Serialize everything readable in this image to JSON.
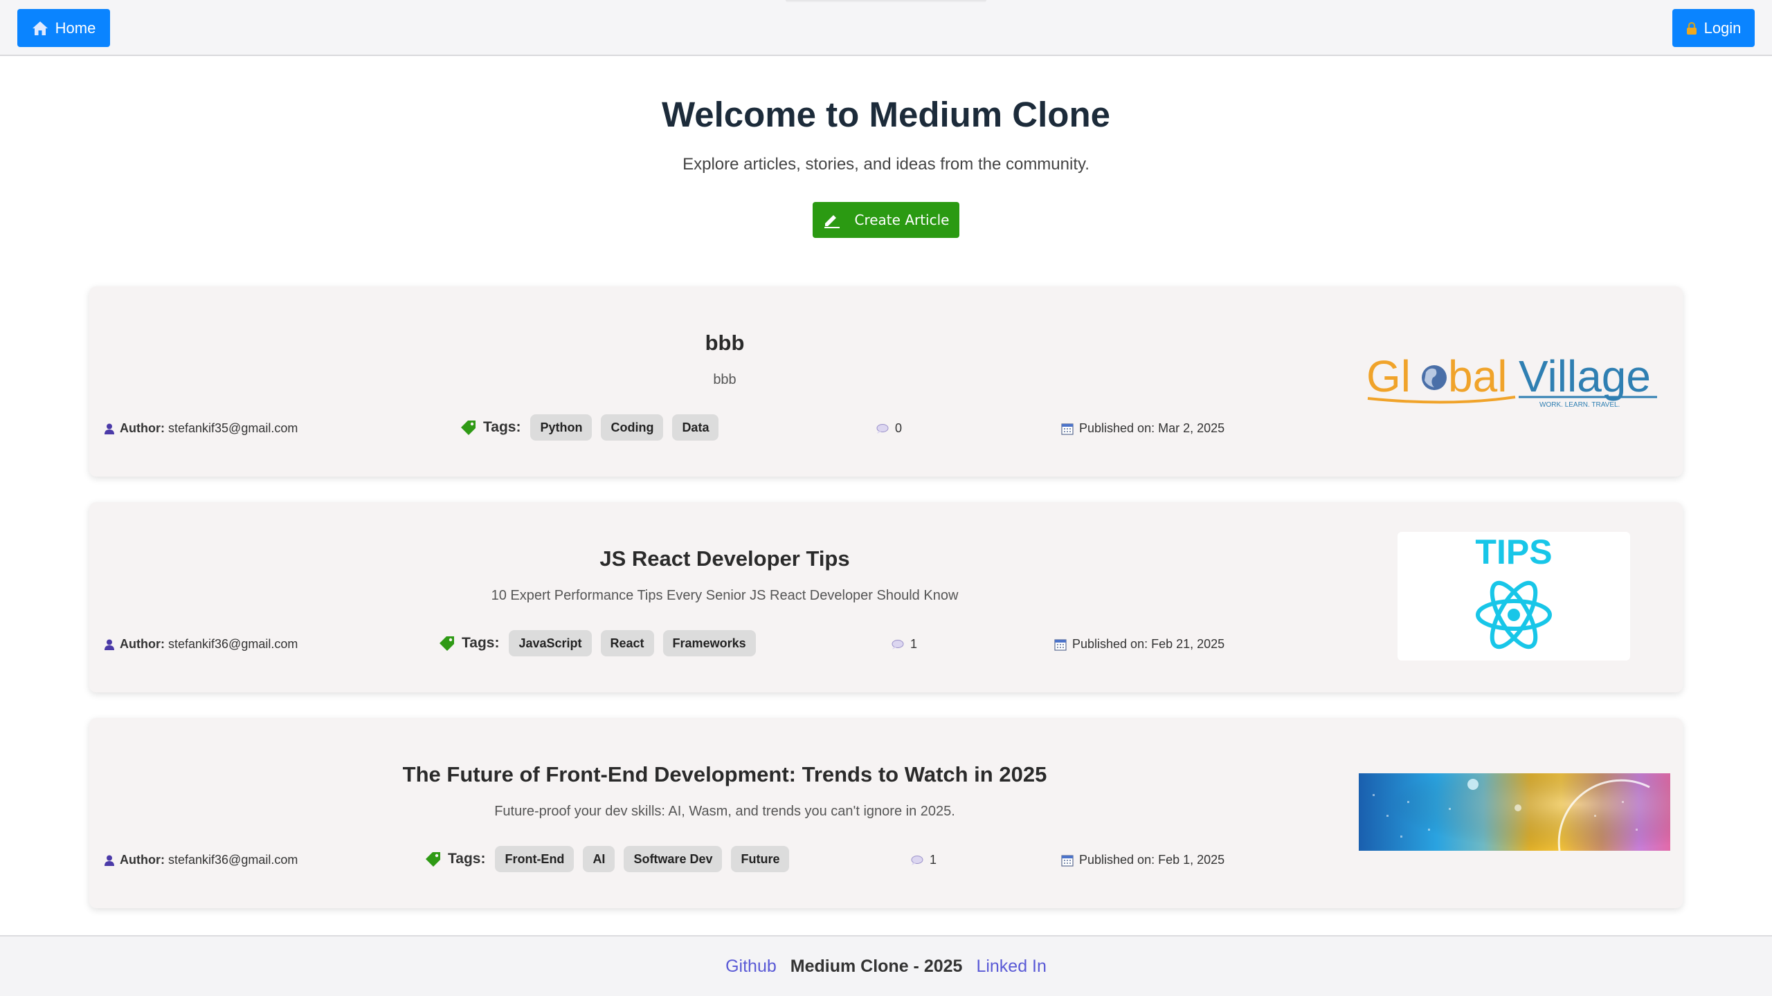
{
  "nav": {
    "home_label": "Home",
    "login_label": "Login"
  },
  "hero": {
    "title": "Welcome to Medium Clone",
    "subtitle": "Explore articles, stories, and ideas from the community.",
    "create_label": "Create Article"
  },
  "articles": [
    {
      "title": "bbb",
      "description": "bbb",
      "author_label": "Author:",
      "author": "stefankif35@gmail.com",
      "tags_label": "Tags:",
      "tags": [
        "Python",
        "Coding",
        "Data"
      ],
      "comments": "0",
      "published": "Published on: Mar 2, 2025",
      "image": {
        "icon": "global-village-logo",
        "text_a": "Gl",
        "text_b": "bal",
        "text_c": "Village",
        "tagline": "WORK. LEARN. TRAVEL."
      }
    },
    {
      "title": "JS React Developer Tips",
      "description": "10 Expert Performance Tips Every Senior JS React Developer Should Know",
      "author_label": "Author:",
      "author": "stefankif36@gmail.com",
      "tags_label": "Tags:",
      "tags": [
        "JavaScript",
        "React",
        "Frameworks"
      ],
      "comments": "1",
      "published": "Published on: Feb 21, 2025",
      "image": {
        "icon": "react-tips-image",
        "text": "TIPS"
      }
    },
    {
      "title": "The Future of Front-End Development: Trends to Watch in 2025",
      "description": "Future-proof your dev skills: AI, Wasm, and trends you can't ignore in 2025.",
      "author_label": "Author:",
      "author": "stefankif36@gmail.com",
      "tags_label": "Tags:",
      "tags": [
        "Front-End",
        "AI",
        "Software Dev",
        "Future"
      ],
      "comments": "1",
      "published": "Published on: Feb 1, 2025",
      "image": {
        "icon": "tech-abstract-image"
      }
    }
  ],
  "footer": {
    "github": "Github",
    "title": "Medium Clone - 2025",
    "linkedin": "Linked In"
  },
  "colors": {
    "primary": "#0a84ff",
    "create": "#2b9a12",
    "footer_link": "#5a5ad6",
    "card_bg": "#f6f3f3"
  }
}
